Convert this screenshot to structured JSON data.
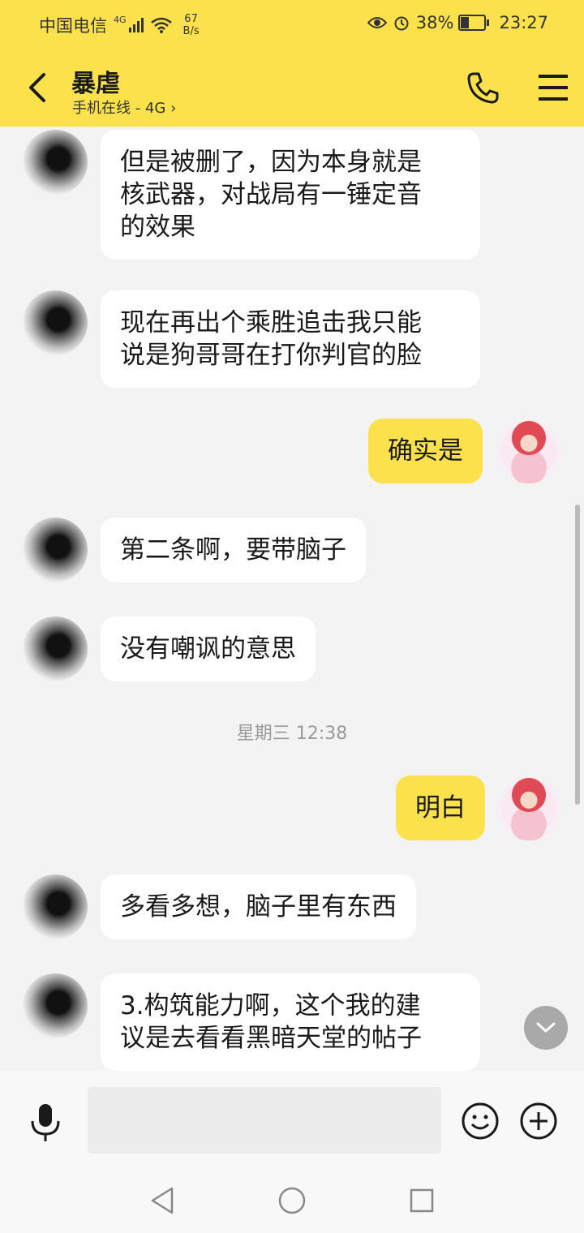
{
  "status_bar": {
    "carrier": "中国电信",
    "network_badge": "4G",
    "net_speed_value": "67",
    "net_speed_unit": "B/s",
    "battery_percent": "38%",
    "time": "23:27"
  },
  "header": {
    "title": "暴虐",
    "subtitle": "手机在线 - 4G"
  },
  "messages": [
    {
      "sender": "them",
      "text_lines": [
        "但是被删了，因为本身就是",
        "核武器，对战局有一锤定音",
        "的效果"
      ]
    },
    {
      "sender": "them",
      "text_lines": [
        "现在再出个乘胜追击我只能",
        "说是狗哥哥在打你判官的脸"
      ]
    },
    {
      "sender": "me",
      "text_lines": [
        "确实是"
      ]
    },
    {
      "sender": "them",
      "text_lines": [
        "第二条啊，要带脑子"
      ]
    },
    {
      "sender": "them",
      "text_lines": [
        "没有嘲讽的意思"
      ]
    },
    {
      "type": "timestamp",
      "text": "星期三 12:38"
    },
    {
      "sender": "me",
      "text_lines": [
        "明白"
      ]
    },
    {
      "sender": "them",
      "text_lines": [
        "多看多想，脑子里有东西"
      ]
    },
    {
      "sender": "them",
      "text_lines": [
        "3.构筑能力啊，这个我的建",
        "议是去看看黑暗天堂的帖子"
      ]
    }
  ],
  "input_bar": {
    "placeholder": ""
  },
  "icons": {
    "back": "back-arrow-icon",
    "call": "phone-icon",
    "menu": "menu-icon",
    "mic": "microphone-icon",
    "emoji": "smiley-icon",
    "plus": "plus-circle-icon",
    "scroll_down": "chevron-down-icon"
  },
  "colors": {
    "header_bg": "#fbe14c",
    "my_bubble": "#fbe14c",
    "their_bubble": "#ffffff",
    "chat_bg": "#f3f3f3"
  }
}
